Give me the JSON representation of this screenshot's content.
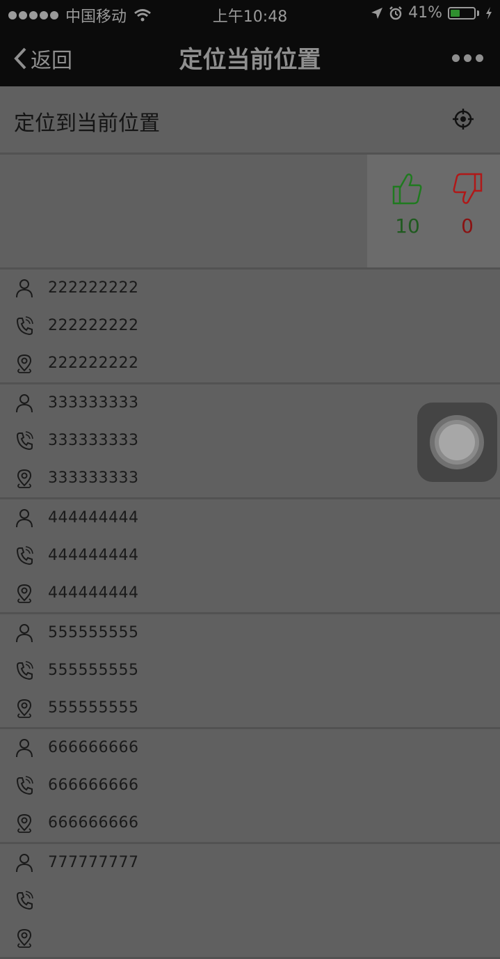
{
  "status_bar": {
    "carrier": "中国移动",
    "time": "上午10:48",
    "battery_percent": "41%",
    "battery_level": 0.41,
    "icons": [
      "signal-dots-icon",
      "wifi-icon",
      "location-arrow-icon",
      "alarm-icon",
      "battery-icon",
      "charging-icon"
    ]
  },
  "nav": {
    "back_label": "返回",
    "title": "定位当前位置",
    "more_icon": "more-icon"
  },
  "locate": {
    "label": "定位到当前位置",
    "icon": "locate-crosshair-icon"
  },
  "rating": {
    "up_count": "10",
    "down_count": "0",
    "up_color": "#1f7a1f",
    "down_color": "#b01818"
  },
  "entries": [
    {
      "name": "222222222",
      "phone": "222222222",
      "address": "222222222"
    },
    {
      "name": "333333333",
      "phone": "333333333",
      "address": "333333333"
    },
    {
      "name": "444444444",
      "phone": "444444444",
      "address": "444444444"
    },
    {
      "name": "555555555",
      "phone": "555555555",
      "address": "555555555"
    },
    {
      "name": "666666666",
      "phone": "666666666",
      "address": "666666666"
    },
    {
      "name": "777777777",
      "phone": "",
      "address": ""
    }
  ],
  "colors": {
    "overlay_background": "#5f5f5f",
    "bar_background": "#0b0b0b"
  }
}
